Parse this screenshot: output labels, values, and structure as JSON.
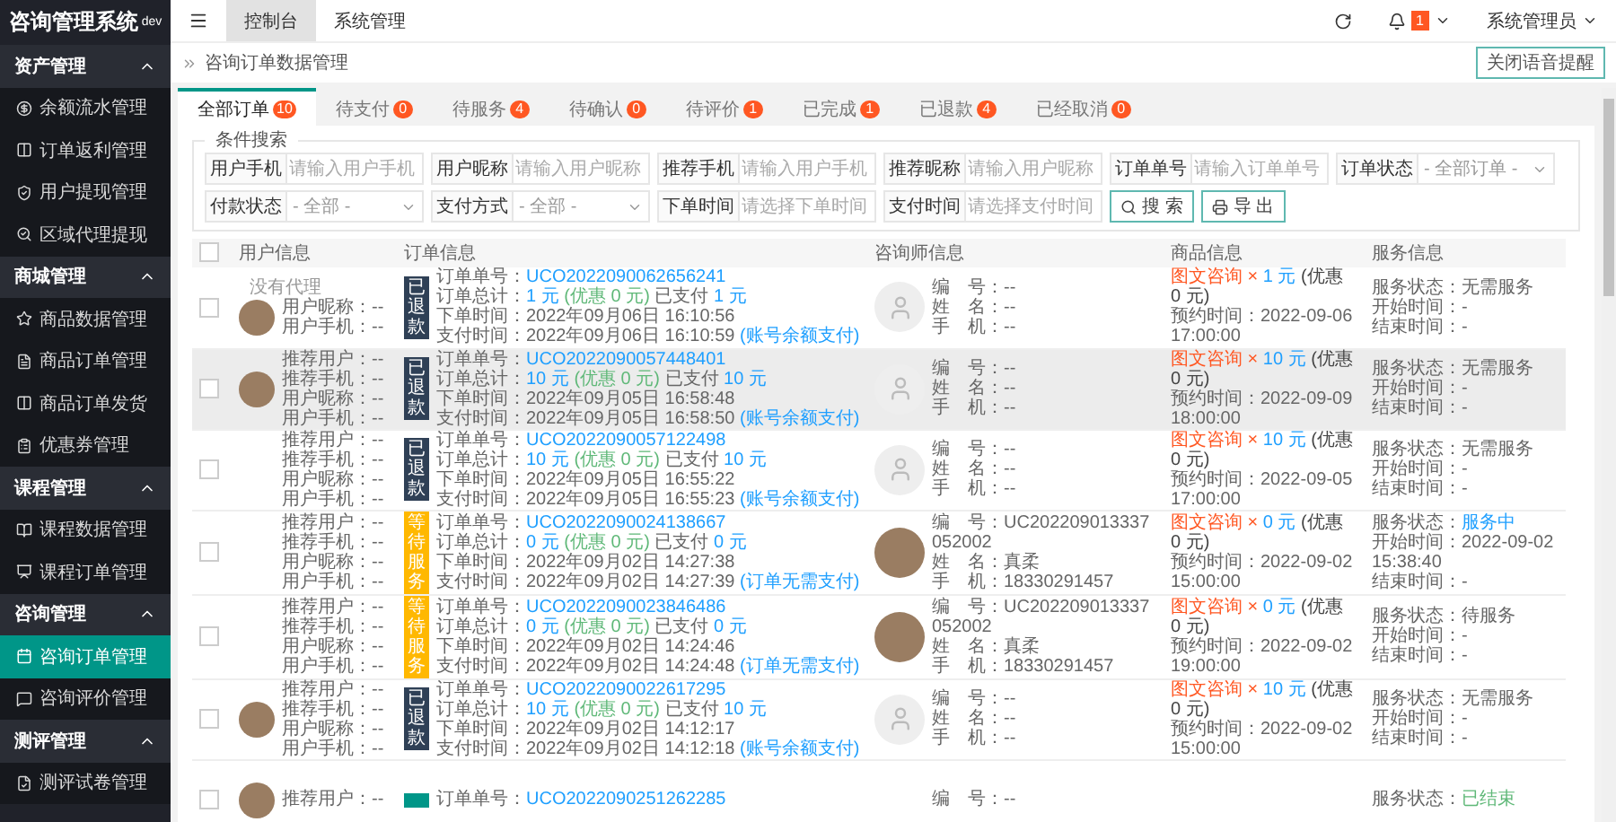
{
  "sidebar": {
    "title": "咨询管理系统",
    "title_tag": "dev",
    "groups": [
      {
        "label": "资产管理",
        "expanded": true,
        "items": [
          {
            "label": "余额流水管理",
            "selected": false
          },
          {
            "label": "订单返利管理",
            "selected": false
          },
          {
            "label": "用户提现管理",
            "selected": false
          },
          {
            "label": "区域代理提现",
            "selected": false
          }
        ]
      },
      {
        "label": "商城管理",
        "expanded": true,
        "items": [
          {
            "label": "商品数据管理",
            "selected": false
          },
          {
            "label": "商品订单管理",
            "selected": false
          },
          {
            "label": "商品订单发货",
            "selected": false
          },
          {
            "label": "优惠券管理",
            "selected": false
          }
        ]
      },
      {
        "label": "课程管理",
        "expanded": true,
        "items": [
          {
            "label": "课程数据管理",
            "selected": false
          },
          {
            "label": "课程订单管理",
            "selected": false
          }
        ]
      },
      {
        "label": "咨询管理",
        "expanded": true,
        "items": [
          {
            "label": "咨询订单管理",
            "selected": true
          },
          {
            "label": "咨询评价管理",
            "selected": false
          }
        ]
      },
      {
        "label": "测评管理",
        "expanded": true,
        "items": [
          {
            "label": "测评试卷管理",
            "selected": false
          }
        ]
      }
    ]
  },
  "topbar": {
    "tabs": [
      {
        "label": "控制台",
        "selected": true
      },
      {
        "label": "系统管理",
        "selected": false
      }
    ],
    "notification_count": "1",
    "user": "系统管理员"
  },
  "breadcrumb": {
    "label": "咨询订单数据管理",
    "action": "关闭语音提醒"
  },
  "order_tabs": [
    {
      "label": "全部订单",
      "count": "10",
      "selected": true
    },
    {
      "label": "待支付",
      "count": "0",
      "selected": false
    },
    {
      "label": "待服务",
      "count": "4",
      "selected": false
    },
    {
      "label": "待确认",
      "count": "0",
      "selected": false
    },
    {
      "label": "待评价",
      "count": "1",
      "selected": false
    },
    {
      "label": "已完成",
      "count": "1",
      "selected": false
    },
    {
      "label": "已退款",
      "count": "4",
      "selected": false
    },
    {
      "label": "已经取消",
      "count": "0",
      "selected": false
    }
  ],
  "search": {
    "legend": "条件搜索",
    "fields": [
      {
        "label": "用户手机",
        "kind": "input",
        "placeholder": "请输入用户手机"
      },
      {
        "label": "用户昵称",
        "kind": "input",
        "placeholder": "请输入用户昵称"
      },
      {
        "label": "推荐手机",
        "kind": "input",
        "placeholder": "请输入用户手机"
      },
      {
        "label": "推荐昵称",
        "kind": "input",
        "placeholder": "请输入用户昵称"
      },
      {
        "label": "订单单号",
        "kind": "input",
        "placeholder": "请输入订单单号"
      },
      {
        "label": "订单状态",
        "kind": "select",
        "value": "- 全部订单 -"
      },
      {
        "label": "付款状态",
        "kind": "select",
        "value": "- 全部 -"
      },
      {
        "label": "支付方式",
        "kind": "select",
        "value": "- 全部 -"
      },
      {
        "label": "下单时间",
        "kind": "input",
        "placeholder": "请选择下单时间"
      },
      {
        "label": "支付时间",
        "kind": "input",
        "placeholder": "请选择支付时间"
      }
    ],
    "buttons": [
      {
        "label": "搜 索",
        "kind": "search"
      },
      {
        "label": "导 出",
        "kind": "export"
      }
    ]
  },
  "table": {
    "all_checked": false,
    "columns": [
      "用户信息",
      "订单信息",
      "咨询师信息",
      "商品信息",
      "服务信息"
    ],
    "rows": [
      {
        "checked": false,
        "highlighted": false,
        "user": {
          "agent": "没有代理",
          "avatar": {
            "kind": "photo"
          },
          "lines": [
            "用户昵称：--",
            "用户手机：--"
          ]
        },
        "status": {
          "kind": "refunded",
          "label": "已退款"
        },
        "order": [
          {
            "label": "订单单号：",
            "segments": [
              {
                "text": "UCO2022090062656241",
                "kind": "link"
              }
            ]
          },
          {
            "label": "订单总计：",
            "segments": [
              {
                "text": "1 元",
                "kind": "amount"
              },
              {
                "text": "(优惠 0 元)",
                "kind": "discount"
              },
              {
                "text": "已支付",
                "kind": "plain"
              },
              {
                "text": "1 元",
                "kind": "amount"
              }
            ]
          },
          {
            "label": "下单时间：",
            "segments": [
              {
                "text": "2022年09月06日 16:10:56",
                "kind": "plain"
              }
            ]
          },
          {
            "label": "支付时间：",
            "segments": [
              {
                "text": "2022年09月06日 16:10:59",
                "kind": "plain"
              },
              {
                "text": "(账号余额支付)",
                "kind": "link"
              }
            ]
          }
        ],
        "consultant": {
          "avatar": {
            "kind": "default"
          },
          "lines": [
            "编　号：--",
            "姓　名：--",
            "手　机：--"
          ]
        },
        "goods": {
          "segments": [
            {
              "text": "图文咨询 ×",
              "kind": "type"
            },
            {
              "text": "1 元",
              "kind": "amount"
            },
            {
              "text": "(优惠 0 元)",
              "kind": "dark"
            }
          ],
          "time": "预约时间：2022-09-06 17:00:00"
        },
        "service": [
          {
            "label": "服务状态：",
            "segments": [
              {
                "text": "无需服务",
                "kind": "plain"
              }
            ]
          },
          {
            "label": "开始时间：",
            "segments": [
              {
                "text": "-",
                "kind": "plain"
              }
            ]
          },
          {
            "label": "结束时间：",
            "segments": [
              {
                "text": "-",
                "kind": "plain"
              }
            ]
          }
        ]
      },
      {
        "checked": false,
        "highlighted": true,
        "user": {
          "avatar": {
            "kind": "photo"
          },
          "lines": [
            "推荐用户：--",
            "推荐手机：--",
            "用户昵称：--",
            "用户手机：--"
          ]
        },
        "status": {
          "kind": "refunded",
          "label": "已退款"
        },
        "order": [
          {
            "label": "订单单号：",
            "segments": [
              {
                "text": "UCO2022090057448401",
                "kind": "link"
              }
            ]
          },
          {
            "label": "订单总计：",
            "segments": [
              {
                "text": "10 元",
                "kind": "amount"
              },
              {
                "text": "(优惠 0 元)",
                "kind": "discount"
              },
              {
                "text": "已支付",
                "kind": "plain"
              },
              {
                "text": "10 元",
                "kind": "amount"
              }
            ]
          },
          {
            "label": "下单时间：",
            "segments": [
              {
                "text": "2022年09月05日 16:58:48",
                "kind": "plain"
              }
            ]
          },
          {
            "label": "支付时间：",
            "segments": [
              {
                "text": "2022年09月05日 16:58:50",
                "kind": "plain"
              },
              {
                "text": "(账号余额支付)",
                "kind": "link"
              }
            ]
          }
        ],
        "consultant": {
          "avatar": {
            "kind": "default"
          },
          "lines": [
            "编　号：--",
            "姓　名：--",
            "手　机：--"
          ]
        },
        "goods": {
          "segments": [
            {
              "text": "图文咨询 ×",
              "kind": "type"
            },
            {
              "text": "10 元",
              "kind": "amount"
            },
            {
              "text": "(优惠 0 元)",
              "kind": "dark"
            }
          ],
          "time": "预约时间：2022-09-09 18:00:00"
        },
        "service": [
          {
            "label": "服务状态：",
            "segments": [
              {
                "text": "无需服务",
                "kind": "plain"
              }
            ]
          },
          {
            "label": "开始时间：",
            "segments": [
              {
                "text": "-",
                "kind": "plain"
              }
            ]
          },
          {
            "label": "结束时间：",
            "segments": [
              {
                "text": "-",
                "kind": "plain"
              }
            ]
          }
        ]
      },
      {
        "checked": false,
        "highlighted": false,
        "user": {
          "lines": [
            "推荐用户：--",
            "推荐手机：--",
            "用户昵称：--",
            "用户手机：--"
          ]
        },
        "status": {
          "kind": "refunded",
          "label": "已退款"
        },
        "order": [
          {
            "label": "订单单号：",
            "segments": [
              {
                "text": "UCO2022090057122498",
                "kind": "link"
              }
            ]
          },
          {
            "label": "订单总计：",
            "segments": [
              {
                "text": "10 元",
                "kind": "amount"
              },
              {
                "text": "(优惠 0 元)",
                "kind": "discount"
              },
              {
                "text": "已支付",
                "kind": "plain"
              },
              {
                "text": "10 元",
                "kind": "amount"
              }
            ]
          },
          {
            "label": "下单时间：",
            "segments": [
              {
                "text": "2022年09月05日 16:55:22",
                "kind": "plain"
              }
            ]
          },
          {
            "label": "支付时间：",
            "segments": [
              {
                "text": "2022年09月05日 16:55:23",
                "kind": "plain"
              },
              {
                "text": "(账号余额支付)",
                "kind": "link"
              }
            ]
          }
        ],
        "consultant": {
          "avatar": {
            "kind": "default"
          },
          "lines": [
            "编　号：--",
            "姓　名：--",
            "手　机：--"
          ]
        },
        "goods": {
          "segments": [
            {
              "text": "图文咨询 ×",
              "kind": "type"
            },
            {
              "text": "10 元",
              "kind": "amount"
            },
            {
              "text": "(优惠 0 元)",
              "kind": "dark"
            }
          ],
          "time": "预约时间：2022-09-05 17:00:00"
        },
        "service": [
          {
            "label": "服务状态：",
            "segments": [
              {
                "text": "无需服务",
                "kind": "plain"
              }
            ]
          },
          {
            "label": "开始时间：",
            "segments": [
              {
                "text": "-",
                "kind": "plain"
              }
            ]
          },
          {
            "label": "结束时间：",
            "segments": [
              {
                "text": "-",
                "kind": "plain"
              }
            ]
          }
        ]
      },
      {
        "checked": false,
        "highlighted": false,
        "user": {
          "lines": [
            "推荐用户：--",
            "推荐手机：--",
            "用户昵称：--",
            "用户手机：--"
          ]
        },
        "status": {
          "kind": "waiting",
          "label": "等待服务"
        },
        "order": [
          {
            "label": "订单单号：",
            "segments": [
              {
                "text": "UCO2022090024138667",
                "kind": "link"
              }
            ]
          },
          {
            "label": "订单总计：",
            "segments": [
              {
                "text": "0 元",
                "kind": "amount"
              },
              {
                "text": "(优惠 0 元)",
                "kind": "discount"
              },
              {
                "text": "已支付",
                "kind": "plain"
              },
              {
                "text": "0 元",
                "kind": "amount"
              }
            ]
          },
          {
            "label": "下单时间：",
            "segments": [
              {
                "text": "2022年09月02日 14:27:38",
                "kind": "plain"
              }
            ]
          },
          {
            "label": "支付时间：",
            "segments": [
              {
                "text": "2022年09月02日 14:27:39",
                "kind": "plain"
              },
              {
                "text": "(订单无需支付)",
                "kind": "link"
              }
            ]
          }
        ],
        "consultant": {
          "avatar": {
            "kind": "photo"
          },
          "lines": [
            "编　号：UC202209013337052002",
            "姓　名：真柔",
            "手　机：18330291457"
          ]
        },
        "goods": {
          "segments": [
            {
              "text": "图文咨询 ×",
              "kind": "type"
            },
            {
              "text": "0 元",
              "kind": "amount"
            },
            {
              "text": "(优惠 0 元)",
              "kind": "dark"
            }
          ],
          "time": "预约时间：2022-09-02 15:00:00"
        },
        "service": [
          {
            "label": "服务状态：",
            "segments": [
              {
                "text": "服务中",
                "kind": "link"
              }
            ]
          },
          {
            "label": "开始时间：",
            "segments": [
              {
                "text": "2022-09-02 15:38:40",
                "kind": "plain"
              }
            ]
          },
          {
            "label": "结束时间：",
            "segments": [
              {
                "text": "-",
                "kind": "plain"
              }
            ]
          }
        ]
      },
      {
        "checked": false,
        "highlighted": false,
        "user": {
          "lines": [
            "推荐用户：--",
            "推荐手机：--",
            "用户昵称：--",
            "用户手机：--"
          ]
        },
        "status": {
          "kind": "waiting",
          "label": "等待服务"
        },
        "order": [
          {
            "label": "订单单号：",
            "segments": [
              {
                "text": "UCO2022090023846486",
                "kind": "link"
              }
            ]
          },
          {
            "label": "订单总计：",
            "segments": [
              {
                "text": "0 元",
                "kind": "amount"
              },
              {
                "text": "(优惠 0 元)",
                "kind": "discount"
              },
              {
                "text": "已支付",
                "kind": "plain"
              },
              {
                "text": "0 元",
                "kind": "amount"
              }
            ]
          },
          {
            "label": "下单时间：",
            "segments": [
              {
                "text": "2022年09月02日 14:24:46",
                "kind": "plain"
              }
            ]
          },
          {
            "label": "支付时间：",
            "segments": [
              {
                "text": "2022年09月02日 14:24:48",
                "kind": "plain"
              },
              {
                "text": "(订单无需支付)",
                "kind": "link"
              }
            ]
          }
        ],
        "consultant": {
          "avatar": {
            "kind": "photo"
          },
          "lines": [
            "编　号：UC202209013337052002",
            "姓　名：真柔",
            "手　机：18330291457"
          ]
        },
        "goods": {
          "segments": [
            {
              "text": "图文咨询 ×",
              "kind": "type"
            },
            {
              "text": "0 元",
              "kind": "amount"
            },
            {
              "text": "(优惠 0 元)",
              "kind": "dark"
            }
          ],
          "time": "预约时间：2022-09-02 19:00:00"
        },
        "service": [
          {
            "label": "服务状态：",
            "segments": [
              {
                "text": "待服务",
                "kind": "plain"
              }
            ]
          },
          {
            "label": "开始时间：",
            "segments": [
              {
                "text": "-",
                "kind": "plain"
              }
            ]
          },
          {
            "label": "结束时间：",
            "segments": [
              {
                "text": "-",
                "kind": "plain"
              }
            ]
          }
        ]
      },
      {
        "checked": false,
        "highlighted": false,
        "user": {
          "avatar": {
            "kind": "photo"
          },
          "lines": [
            "推荐用户：--",
            "推荐手机：--",
            "用户昵称：--",
            "用户手机：--"
          ]
        },
        "status": {
          "kind": "refunded",
          "label": "已退款"
        },
        "order": [
          {
            "label": "订单单号：",
            "segments": [
              {
                "text": "UCO2022090022617295",
                "kind": "link"
              }
            ]
          },
          {
            "label": "订单总计：",
            "segments": [
              {
                "text": "10 元",
                "kind": "amount"
              },
              {
                "text": "(优惠 0 元)",
                "kind": "discount"
              },
              {
                "text": "已支付",
                "kind": "plain"
              },
              {
                "text": "10 元",
                "kind": "amount"
              }
            ]
          },
          {
            "label": "下单时间：",
            "segments": [
              {
                "text": "2022年09月02日 14:12:17",
                "kind": "plain"
              }
            ]
          },
          {
            "label": "支付时间：",
            "segments": [
              {
                "text": "2022年09月02日 14:12:18",
                "kind": "plain"
              },
              {
                "text": "(账号余额支付)",
                "kind": "link"
              }
            ]
          }
        ],
        "consultant": {
          "avatar": {
            "kind": "default"
          },
          "lines": [
            "编　号：--",
            "姓　名：--",
            "手　机：--"
          ]
        },
        "goods": {
          "segments": [
            {
              "text": "图文咨询 ×",
              "kind": "type"
            },
            {
              "text": "10 元",
              "kind": "amount"
            },
            {
              "text": "(优惠 0 元)",
              "kind": "dark"
            }
          ],
          "time": "预约时间：2022-09-02 15:00:00"
        },
        "service": [
          {
            "label": "服务状态：",
            "segments": [
              {
                "text": "无需服务",
                "kind": "plain"
              }
            ]
          },
          {
            "label": "开始时间：",
            "segments": [
              {
                "text": "-",
                "kind": "plain"
              }
            ]
          },
          {
            "label": "结束时间：",
            "segments": [
              {
                "text": "-",
                "kind": "plain"
              }
            ]
          }
        ]
      },
      {
        "checked": false,
        "highlighted": false,
        "user": {
          "avatar": {
            "kind": "photo"
          },
          "lines": [
            "推荐用户：--"
          ]
        },
        "status": {
          "kind": "done"
        },
        "order": [
          {
            "label": "订单单号：",
            "segments": [
              {
                "text": "UCO2022090251262285",
                "kind": "link"
              }
            ]
          }
        ],
        "consultant": {
          "lines": [
            "编　号：--"
          ]
        },
        "service": [
          {
            "label": "服务状态：",
            "segments": [
              {
                "text": "已结束",
                "kind": "ended"
              }
            ]
          }
        ]
      }
    ]
  }
}
